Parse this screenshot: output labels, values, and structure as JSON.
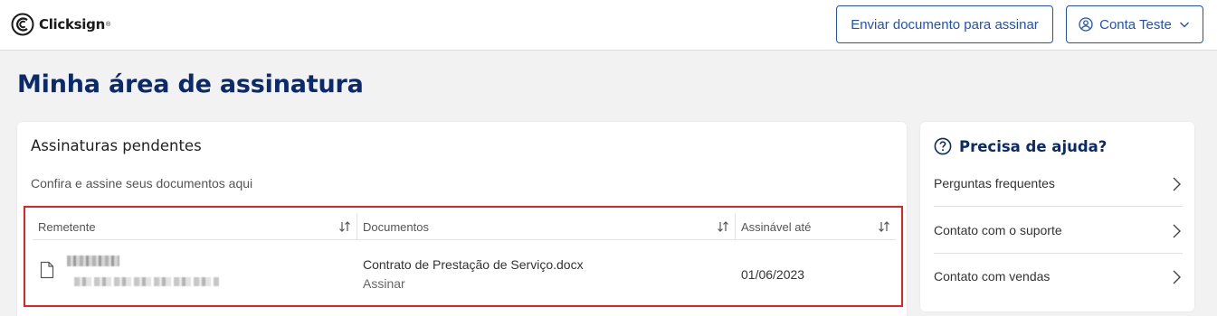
{
  "header": {
    "brand": "Clicksign",
    "brand_mark": "®",
    "send_button": "Enviar documento para assinar",
    "account_button": "Conta Teste",
    "icons": {
      "account": "user-circle-icon",
      "dropdown": "chevron-down-icon"
    }
  },
  "page_title": "Minha área de assinatura",
  "pending": {
    "title": "Assinaturas pendentes",
    "subtitle": "Confira e assine seus documentos aqui",
    "columns": [
      "Remetente",
      "Documentos",
      "Assinável até"
    ],
    "rows": [
      {
        "document": "Contrato de Prestação de Serviço.docx",
        "action": "Assinar",
        "deadline": "01/06/2023"
      }
    ]
  },
  "help": {
    "title": "Precisa de ajuda?",
    "items": [
      "Perguntas frequentes",
      "Contato com o suporte",
      "Contato com vendas"
    ]
  },
  "colors": {
    "primary": "#1e4fd0",
    "title": "#0b2a6b",
    "highlight": "#e02424"
  }
}
